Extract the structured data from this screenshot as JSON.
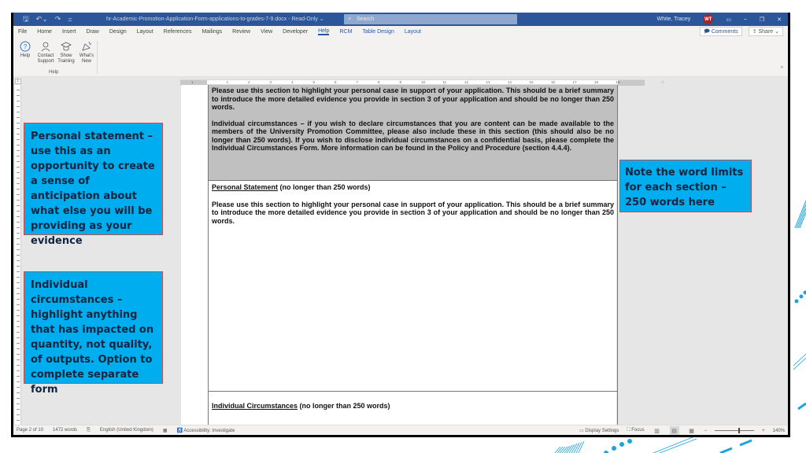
{
  "titlebar": {
    "document_title": "hr-Academic-Promotion-Application-Form-applications-to-grades-7-9.docx - Read-Only",
    "read_only_dropdown": "⌄",
    "search_placeholder": "Search",
    "user_name": "White, Tracey",
    "user_initials": "WT"
  },
  "menubar": {
    "items": [
      "File",
      "Home",
      "Insert",
      "Draw",
      "Design",
      "Layout",
      "References",
      "Mailings",
      "Review",
      "View",
      "Developer",
      "Help",
      "RCM",
      "Table Design",
      "Layout"
    ],
    "active": "Help",
    "comments_label": "Comments",
    "share_label": "Share"
  },
  "ribbon": {
    "buttons": [
      {
        "icon": "help-icon",
        "label": "Help"
      },
      {
        "icon": "contact-support-icon",
        "label": "Contact Support"
      },
      {
        "icon": "show-training-icon",
        "label": "Show Training"
      },
      {
        "icon": "whats-new-icon",
        "label": "What's New"
      }
    ],
    "group_label": "Help"
  },
  "ruler": {
    "numbers": [
      "1",
      "1",
      "2",
      "3",
      "4",
      "5",
      "6",
      "7",
      "8",
      "9",
      "10",
      "11",
      "12",
      "13",
      "14",
      "15",
      "16",
      "17",
      "18",
      "19"
    ]
  },
  "document": {
    "grey_cell": {
      "para1": "Please use this section to highlight your personal case in support of your application.  This should be a brief summary to introduce the more detailed evidence you provide in section 3 of your application and should be no longer than 250 words.",
      "para2": "Individual circumstances – if you wish to declare circumstances that you are content can be made available to the members of the University Promotion Committee, please also include these in this section (this should also be no longer than 250 words).  If you wish to disclose individual circumstances on a confidential basis, please complete the Individual Circumstances Form.  More information can be found in the Policy and Procedure (section 4.4.4)."
    },
    "personal_statement": {
      "heading": "Personal Statement",
      "heading_suffix": " (no longer than 250 words)",
      "body": "Please use this section to highlight your personal case in support of your application.  This should be a brief summary to introduce the more detailed evidence you provide in section 3 of your application and should be no longer than 250 words."
    },
    "individual_circumstances": {
      "heading": "Individual Circumstances",
      "heading_suffix": " (no longer than 250 words)"
    }
  },
  "callouts": {
    "personal_statement": "Personal statement – use this as an opportunity to create a sense of anticipation about what else you will be providing as your evidence",
    "individual_circumstances": "Individual circumstances – highlight anything that has impacted on quantity, not quality, of outputs. Option to complete separate form",
    "word_limits": "Note the word limits for each section – 250 words here"
  },
  "statusbar": {
    "page": "Page 2 of 10",
    "words": "1472 words",
    "language": "English (United Kingdom)",
    "accessibility": "Accessibility: Investigate",
    "display_settings": "Display Settings",
    "focus": "Focus",
    "zoom_level": "140%",
    "zoom_fraction": 0.62
  },
  "colors": {
    "title_bar": "#2b579a",
    "callout_fill": "#00aeef",
    "callout_border": "#c0504d",
    "callout_text": "#10243f",
    "decoration": "#1aa3dd"
  }
}
